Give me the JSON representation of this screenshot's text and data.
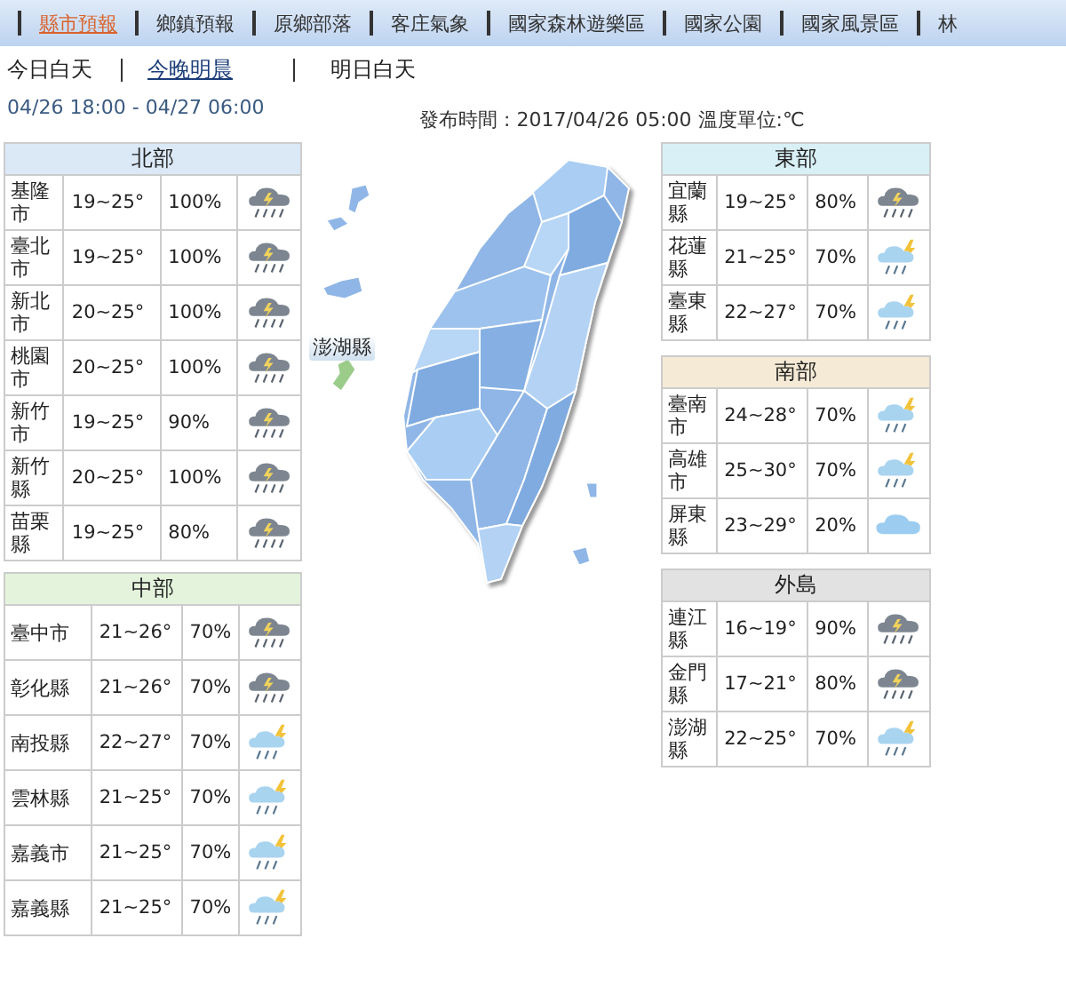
{
  "tabs": [
    {
      "label": "縣市預報",
      "selected": true
    },
    {
      "label": "鄉鎮預報",
      "selected": false
    },
    {
      "label": "原鄉部落",
      "selected": false
    },
    {
      "label": "客庄氣象",
      "selected": false
    },
    {
      "label": "國家森林遊樂區",
      "selected": false
    },
    {
      "label": "國家公園",
      "selected": false
    },
    {
      "label": "國家風景區",
      "selected": false
    },
    {
      "label": "林",
      "selected": false
    }
  ],
  "subtabs": [
    {
      "label": "今日白天",
      "selected": false
    },
    {
      "label": "今晚明晨",
      "selected": true
    },
    {
      "label": "明日白天",
      "selected": false
    }
  ],
  "period": "04/26 18:00 - 04/27 06:00",
  "issued": "發布時間 : 2017/04/26 05:00 溫度單位:℃",
  "map": {
    "label": "澎湖縣"
  },
  "columns": [
    {
      "regions": [
        {
          "name": "北部",
          "color": "#dbe9f7",
          "rows": [
            {
              "city": "基隆市",
              "temp": "19~25°",
              "rain": "100%",
              "kind": "storm"
            },
            {
              "city": "臺北市",
              "temp": "19~25°",
              "rain": "100%",
              "kind": "storm"
            },
            {
              "city": "新北市",
              "temp": "20~25°",
              "rain": "100%",
              "kind": "storm"
            },
            {
              "city": "桃園市",
              "temp": "20~25°",
              "rain": "100%",
              "kind": "storm"
            },
            {
              "city": "新竹市",
              "temp": "19~25°",
              "rain": "90%",
              "kind": "storm"
            },
            {
              "city": "新竹縣",
              "temp": "20~25°",
              "rain": "100%",
              "kind": "storm"
            },
            {
              "city": "苗栗縣",
              "temp": "19~25°",
              "rain": "80%",
              "kind": "storm"
            }
          ]
        },
        {
          "name": "中部",
          "color": "#e4f4dc",
          "rows": [
            {
              "city": "臺中市",
              "temp": "21~26°",
              "rain": "70%",
              "kind": "storm"
            },
            {
              "city": "彰化縣",
              "temp": "21~26°",
              "rain": "70%",
              "kind": "storm"
            },
            {
              "city": "南投縣",
              "temp": "22~27°",
              "rain": "70%",
              "kind": "thunder"
            },
            {
              "city": "雲林縣",
              "temp": "21~25°",
              "rain": "70%",
              "kind": "thunder"
            },
            {
              "city": "嘉義市",
              "temp": "21~25°",
              "rain": "70%",
              "kind": "thunder"
            },
            {
              "city": "嘉義縣",
              "temp": "21~25°",
              "rain": "70%",
              "kind": "thunder"
            }
          ]
        }
      ]
    },
    {
      "regions": [
        {
          "name": "東部",
          "color": "#d9f0f7",
          "rows": [
            {
              "city": "宜蘭縣",
              "temp": "19~25°",
              "rain": "80%",
              "kind": "storm"
            },
            {
              "city": "花蓮縣",
              "temp": "21~25°",
              "rain": "70%",
              "kind": "thunder"
            },
            {
              "city": "臺東縣",
              "temp": "22~27°",
              "rain": "70%",
              "kind": "thunder"
            }
          ]
        },
        {
          "name": "南部",
          "color": "#f5ead5",
          "rows": [
            {
              "city": "臺南市",
              "temp": "24~28°",
              "rain": "70%",
              "kind": "thunder"
            },
            {
              "city": "高雄市",
              "temp": "25~30°",
              "rain": "70%",
              "kind": "thunder"
            },
            {
              "city": "屏東縣",
              "temp": "23~29°",
              "rain": "20%",
              "kind": "cloud"
            }
          ]
        },
        {
          "name": "外島",
          "color": "#e2e2e2",
          "rows": [
            {
              "city": "連江縣",
              "temp": "16~19°",
              "rain": "90%",
              "kind": "storm"
            },
            {
              "city": "金門縣",
              "temp": "17~21°",
              "rain": "80%",
              "kind": "storm"
            },
            {
              "city": "澎湖縣",
              "temp": "22~25°",
              "rain": "70%",
              "kind": "thunder"
            }
          ]
        }
      ]
    }
  ]
}
